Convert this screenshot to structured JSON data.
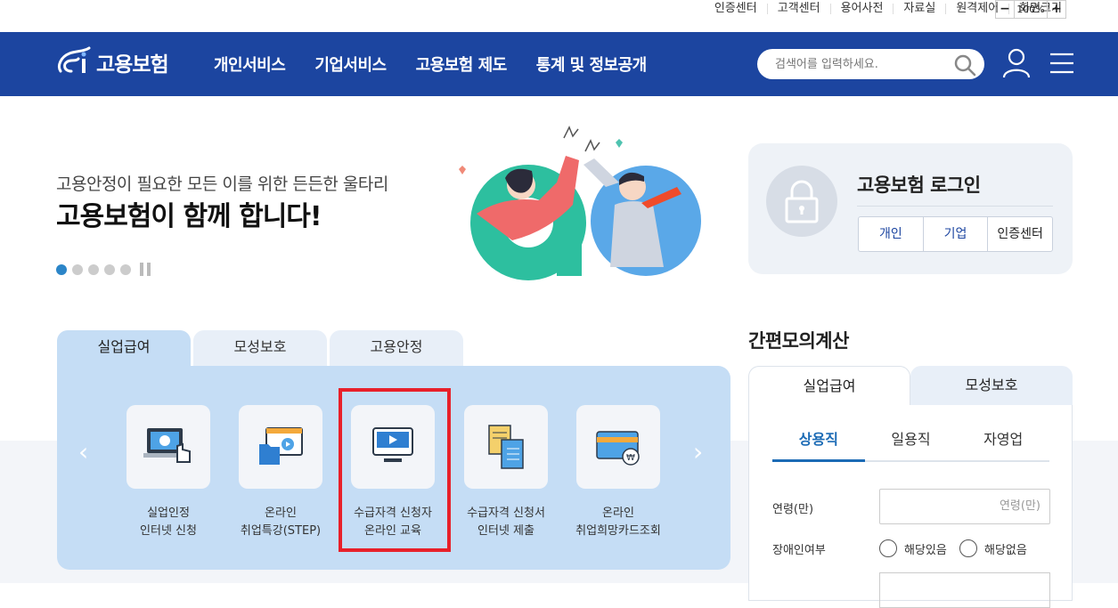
{
  "util": {
    "links": [
      "인증센터",
      "고객센터",
      "용어사전",
      "자료실",
      "원격제어",
      "화면크기"
    ],
    "zoom_minus": "−",
    "zoom_value": "100%",
    "zoom_plus": "+"
  },
  "header": {
    "logo_text": "고용보험",
    "menu": [
      "개인서비스",
      "기업서비스",
      "고용보험 제도",
      "통계 및 정보공개"
    ],
    "search_placeholder": "검색어를 입력하세요."
  },
  "hero": {
    "subtitle": "고용안정이 필요한 모든 이를 위한 든든한 울타리",
    "title": "고용보험이 함께 합니다!",
    "active_slide": 1,
    "slide_count": 5
  },
  "login": {
    "title": "고용보험 로그인",
    "buttons": [
      "개인",
      "기업",
      "인증센터"
    ]
  },
  "services": {
    "tabs": [
      "실업급여",
      "모성보호",
      "고용안정"
    ],
    "active_tab": 0,
    "items": [
      {
        "line1": "실업인정",
        "line2": "인터넷 신청",
        "icon": "laptop-touch-icon"
      },
      {
        "line1": "온라인",
        "line2": "취업특강(STEP)",
        "icon": "video-folder-icon"
      },
      {
        "line1": "수급자격 신청자",
        "line2": "온라인 교육",
        "icon": "monitor-play-icon",
        "highlighted": true
      },
      {
        "line1": "수급자격 신청서",
        "line2": "인터넷 제출",
        "icon": "documents-icon"
      },
      {
        "line1": "온라인",
        "line2": "취업희망카드조회",
        "icon": "card-icon"
      }
    ],
    "prev_arrow": "‹",
    "next_arrow": "›"
  },
  "calculator": {
    "title": "간편모의계산",
    "tabs": [
      "실업급여",
      "모성보호"
    ],
    "subtabs": [
      "상용직",
      "일용직",
      "자영업"
    ],
    "age_label": "연령(만)",
    "age_placeholder": "연령(만)",
    "disability_label": "장애인여부",
    "radio_yes": "해당있음",
    "radio_no": "해당없음"
  },
  "colors": {
    "brand_blue": "#1c45a0",
    "accent_blue": "#1c6bb5",
    "panel_blue": "#c5ddf5",
    "highlight_red": "#e8202a"
  }
}
